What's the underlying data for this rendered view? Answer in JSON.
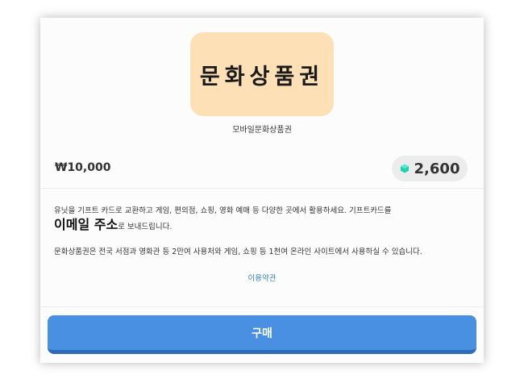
{
  "product": {
    "image_text": "문화상품권",
    "name": "모바일문화상품권",
    "price": "₩10,000",
    "coin_price": "2,600",
    "coin_icon": "gem-icon",
    "coin_color": "#1fd1b0"
  },
  "description": {
    "line1": "유닛을 기프트 카드로 교환하고 게임, 편의점, 쇼핑, 영화 예매 등 다양한 곳에서 활용하세요. 기프트카드를",
    "line2_emphasis": "이메일 주소",
    "line2_rest": "로 보내드립니다.",
    "line3": "문화상품권은 전국 서점과 영화관 등 2만여 사용처와 게임, 쇼핑 등 1천여 온라인 사이트에서 사용하실 수 있습니다."
  },
  "terms_link": "이용약관",
  "buy_button": "구매",
  "colors": {
    "accent": "#4a90e2",
    "card_image_bg": "#fde0b6",
    "link": "#3a82b8"
  }
}
